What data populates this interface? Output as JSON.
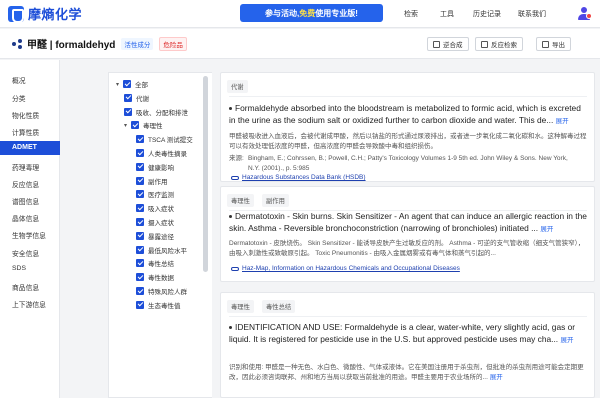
{
  "topnav": {
    "logo_text": "摩熵化学",
    "promo": {
      "prefix": "参与活动,",
      "highlight": "免费",
      "suffix": "使用专业版!"
    },
    "links": [
      "检索",
      "工具",
      "历史记录",
      "联系我们"
    ]
  },
  "titlebar": {
    "title": "甲醛 | formaldehyd",
    "tags": [
      "活性成分",
      "危险品"
    ],
    "buttons": [
      "逆合成",
      "反应检索",
      "导出"
    ]
  },
  "leftnav": {
    "items": [
      "概况",
      "分类",
      "物化性质",
      "计算性质",
      "ADMET",
      "药理毒理",
      "反应信息",
      "谱图信息",
      "晶体信息",
      "生物学信息",
      "安全信息",
      "SDS",
      "商品信息",
      "上下游信息"
    ],
    "active": "ADMET"
  },
  "tree": {
    "rows": [
      {
        "label": "全部",
        "level": 0,
        "caret": true
      },
      {
        "label": "代谢",
        "level": 1,
        "caret": false
      },
      {
        "label": "吸收、分配和排泄",
        "level": 1,
        "caret": false
      },
      {
        "label": "毒理性",
        "level": 1,
        "caret": true
      },
      {
        "label": "TSCA 测试提交",
        "level": 2,
        "caret": false
      },
      {
        "label": "人类毒性摘录",
        "level": 2,
        "caret": false
      },
      {
        "label": "健康影响",
        "level": 2,
        "caret": false
      },
      {
        "label": "副作用",
        "level": 2,
        "caret": false
      },
      {
        "label": "医疗监测",
        "level": 2,
        "caret": false
      },
      {
        "label": "吸入症状",
        "level": 2,
        "caret": false
      },
      {
        "label": "摄入症状",
        "level": 2,
        "caret": false
      },
      {
        "label": "暴露途径",
        "level": 2,
        "caret": false
      },
      {
        "label": "最低风险水平",
        "level": 2,
        "caret": false
      },
      {
        "label": "毒性总结",
        "level": 2,
        "caret": false
      },
      {
        "label": "毒性数据",
        "level": 2,
        "caret": false
      },
      {
        "label": "特殊风险人群",
        "level": 2,
        "caret": false
      },
      {
        "label": "生态毒性值",
        "level": 2,
        "caret": false
      }
    ]
  },
  "cards": [
    {
      "tags": [
        "代谢"
      ],
      "text": "Formaldehyde absorbed into the bloodstream is metabolized to formic acid, which is excreted in the urine as the sodium salt or oxidized further to carbon dioxide and water. This de...",
      "more": "展开",
      "translation": "甲醛被吸收进入血液后，会被代谢成甲酸，然后以钠盐的形式通过尿液排出，或者进一步氧化成二氧化碳和水。这种解毒过程可以有效处理低浓度的甲醛，但高浓度的甲醛会导致酸中毒和组织损伤。",
      "ref_label": "来源:",
      "ref": "Bingham, E.; Cohrssen, B.; Powell, C.H.; Patty's Toxicology Volumes 1-9 5th ed. John Wiley & Sons. New York, N.Y. (2001)., p. 5:985",
      "link": "Hazardous Substances Data Bank (HSDB)"
    },
    {
      "tags": [
        "毒理性",
        "副作用"
      ],
      "text": "Dermatotoxin - Skin burns. Skin Sensitizer - An agent that can induce an allergic reaction in the skin. Asthma - Reversible bronchoconstriction (narrowing of bronchioles) initiated ...",
      "more": "展开",
      "translation": "Dermatotoxin - 皮肤烧伤。 Skin Sensitizer - 能诱导皮肤产生过敏反应的剂。 Asthma - 可逆的支气管收缩（细支气管狭窄），由吸入刺激性或致敏原引起。 Toxic Pneumonitis - 由吸入金属烟雾或有毒气体和蒸气引起的...",
      "link": "Haz-Map, Information on Hazardous Chemicals and Occupational Diseases"
    },
    {
      "tags": [
        "毒理性",
        "毒性总结"
      ],
      "text": "IDENTIFICATION AND USE: Formaldehyde is a clear, water-white, very slightly acid, gas or liquid. It is registered for pesticide use in the U.S. but approved pesticide uses may cha...",
      "more": "展开",
      "translation": "识别和使用: 甲醛是一种无色、水白色、微酸性、气体或液体。它在美国注册用于杀虫剂，但批准的杀虫剂用途可能会定期更改，因此必须咨询联邦、州和地方当局以获取当前批准的用途。甲醛主要用于农业场所的..."
    }
  ]
}
